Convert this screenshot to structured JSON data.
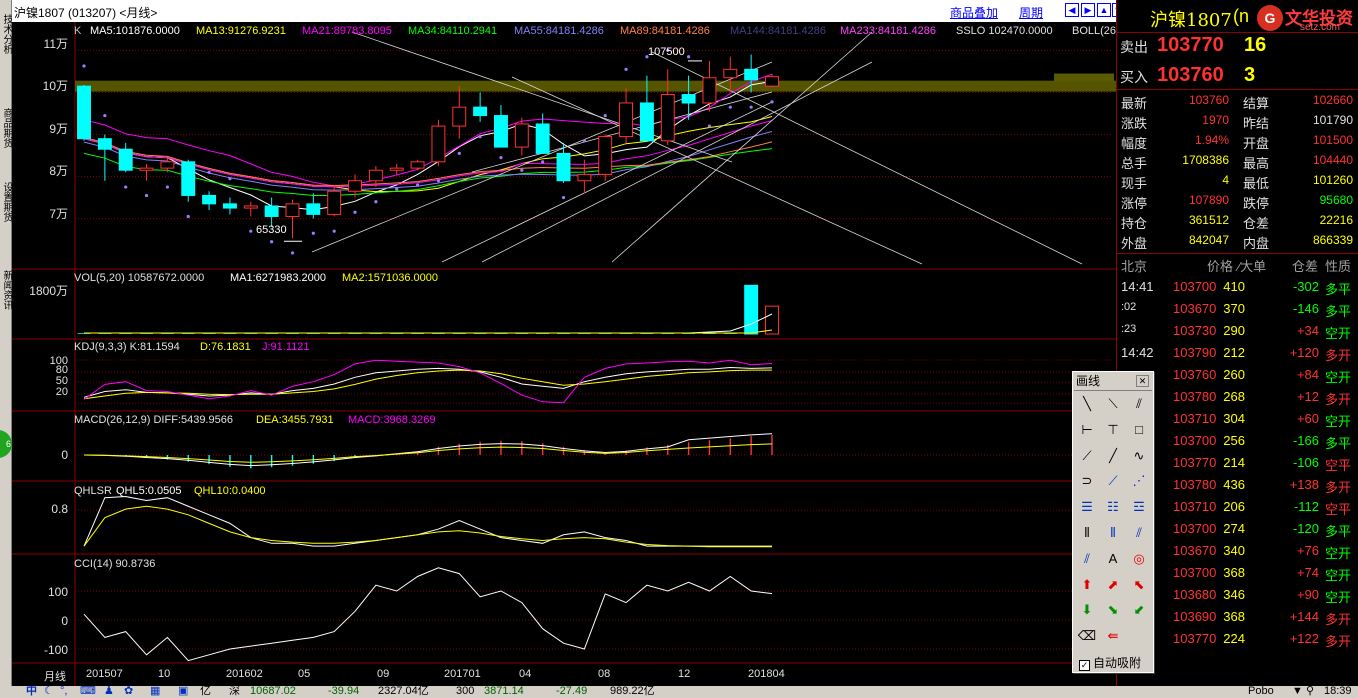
{
  "title_bar": {
    "title": "沪镍1807 (013207) <月线>",
    "link_overlay": "商品叠加",
    "link_period": "周期"
  },
  "left_tabs": [
    "技术分析",
    "商品期货",
    "设置期货",
    "新闻资讯"
  ],
  "chart_labels": {
    "k_name": "K",
    "ma5": "MA5:101876.0000",
    "ma13": "MA13:91276.9231",
    "ma21": "MA21:89783.8095",
    "ma34": "MA34:84110.2941",
    "ma55": "MA55:84181.4286",
    "ma89": "MA89:84181.4286",
    "ma144": "MA144:84181.4286",
    "ma233": "MA233:84181.4286",
    "sslo": "SSLO 102470.0000",
    "boll": "BOLL(26",
    "annot_high": "107500",
    "annot_low": "65330",
    "vol": "VOL(5,20) 10587672.0000",
    "vol_ma1": "MA1:6271983.2000",
    "vol_ma2": "MA2:1571036.0000",
    "kdj": "KDJ(9,3,3) K:81.1594",
    "kdj_d": "D:76.1831",
    "kdj_j": "J:91.1121",
    "macd": "MACD(26,12,9) DIFF:5439.9566",
    "macd_dea": "DEA:3455.7931",
    "macd_val": "MACD:3968.3269",
    "qhlsr": "QHLSR",
    "qhl5": "QHL5:0.0505",
    "qhl10": "QHL10:0.0400",
    "cci": "CCI(14) 90.8736"
  },
  "y_ticks": {
    "price": [
      "11万",
      "10万",
      "9万",
      "8万",
      "7万"
    ],
    "vol": [
      "1800万"
    ],
    "kdj": [
      "100",
      "80",
      "50",
      "20"
    ],
    "macd": [
      "0"
    ],
    "qhlsr": [
      "0.8"
    ],
    "cci": [
      "100",
      "0",
      "-100"
    ]
  },
  "x_axis": {
    "label": "月线",
    "ticks": [
      "201507",
      "10",
      "201602",
      "05",
      "09",
      "201701",
      "04",
      "08",
      "12",
      "201804"
    ]
  },
  "quote": {
    "symbol": "沪镍1807",
    "symbol_code": "(n",
    "brand": "文华投资",
    "brand_url": "setz.com",
    "sell": {
      "label": "卖出",
      "price": "103770",
      "qty": "16"
    },
    "buy": {
      "label": "买入",
      "price": "103760",
      "qty": "3"
    },
    "fields": [
      {
        "l1": "最新",
        "v1": "103760",
        "l2": "结算",
        "v2": "102660"
      },
      {
        "l1": "涨跌",
        "v1": "1970",
        "l2": "昨结",
        "v2": "101790"
      },
      {
        "l1": "幅度",
        "v1": "1.94%",
        "l2": "开盘",
        "v2": "101500"
      },
      {
        "l1": "总手",
        "v1": "1708386",
        "l2": "最高",
        "v2": "104440"
      },
      {
        "l1": "现手",
        "v1": "4",
        "l2": "最低",
        "v2": "101260"
      },
      {
        "l1": "涨停",
        "v1": "107890",
        "l2": "跌停",
        "v2": "95680"
      },
      {
        "l1": "持仓",
        "v1": "361512",
        "l2": "仓差",
        "v2": "22216"
      },
      {
        "l1": "外盘",
        "v1": "842047",
        "l2": "内盘",
        "v2": "866339"
      }
    ],
    "ticks_header": {
      "city": "北京",
      "price": "价格",
      "big": "⁄大单",
      "diff": "仓差",
      "nature": "性质"
    },
    "ticks": [
      {
        "time": "14:41",
        "price": "103700",
        "vol": "410",
        "diff": "-302",
        "nature": "多平"
      },
      {
        "time": ":02",
        "price": "103670",
        "vol": "370",
        "diff": "-146",
        "nature": "多平"
      },
      {
        "time": ":23",
        "price": "103730",
        "vol": "290",
        "diff": "+34",
        "nature": "空开"
      },
      {
        "time": "14:42",
        "price": "103790",
        "vol": "212",
        "diff": "+120",
        "nature": "多开"
      },
      {
        "time": "",
        "price": "103760",
        "vol": "260",
        "diff": "+84",
        "nature": "空开"
      },
      {
        "time": "",
        "price": "103780",
        "vol": "268",
        "diff": "+12",
        "nature": "多开"
      },
      {
        "time": "",
        "price": "103710",
        "vol": "304",
        "diff": "+60",
        "nature": "空开"
      },
      {
        "time": "",
        "price": "103700",
        "vol": "256",
        "diff": "-166",
        "nature": "多平"
      },
      {
        "time": "",
        "price": "103770",
        "vol": "214",
        "diff": "-106",
        "nature": "空平"
      },
      {
        "time": "",
        "price": "103780",
        "vol": "436",
        "diff": "+138",
        "nature": "多开"
      },
      {
        "time": "",
        "price": "103710",
        "vol": "206",
        "diff": "-112",
        "nature": "空平"
      },
      {
        "time": "",
        "price": "103700",
        "vol": "274",
        "diff": "-120",
        "nature": "多平"
      },
      {
        "time": "",
        "price": "103670",
        "vol": "340",
        "diff": "+76",
        "nature": "空开"
      },
      {
        "time": "",
        "price": "103700",
        "vol": "368",
        "diff": "+74",
        "nature": "空开"
      },
      {
        "time": "",
        "price": "103680",
        "vol": "346",
        "diff": "+90",
        "nature": "空开"
      },
      {
        "time": "",
        "price": "103690",
        "vol": "368",
        "diff": "+144",
        "nature": "多开"
      },
      {
        "time": "",
        "price": "103770",
        "vol": "224",
        "diff": "+122",
        "nature": "多开"
      }
    ]
  },
  "draw_tools": {
    "title": "画线",
    "auto_snap": "自动吸附"
  },
  "status_bar": {
    "ime": "中",
    "sh_label": "亿",
    "sz_label": "深",
    "sz_val": "10687.02",
    "sz_chg": "-39.94",
    "sz_amt": "2327.04亿",
    "i300_label": "300",
    "i300_val": "3871.14",
    "i300_chg": "-27.49",
    "i300_amt": "989.22亿",
    "right_text": "Pobo",
    "clock": "18:39"
  },
  "colors": {
    "up": "#ff3232",
    "down": "#00ffff",
    "ma5": "#ffffff",
    "ma13": "#ffff00",
    "ma21": "#ff00ff",
    "ma34": "#00ff00",
    "ma55": "#8080ff",
    "ma89": "#ff8040",
    "title_link": "#0000ff"
  },
  "chart_data": {
    "type": "candlestick",
    "period": "monthly",
    "x": [
      "201507",
      "201508",
      "201509",
      "201510",
      "201511",
      "201512",
      "201601",
      "201602",
      "201603",
      "201604",
      "201605",
      "201606",
      "201607",
      "201608",
      "201609",
      "201610",
      "201611",
      "201612",
      "201701",
      "201702",
      "201703",
      "201704",
      "201705",
      "201706",
      "201707",
      "201708",
      "201709",
      "201710",
      "201711",
      "201712",
      "201801",
      "201802",
      "201803",
      "201804"
    ],
    "ohlc": [
      [
        101500,
        101800,
        88500,
        89000
      ],
      [
        89000,
        90000,
        79000,
        86500
      ],
      [
        86500,
        88000,
        81000,
        81500
      ],
      [
        81500,
        83000,
        79000,
        82000
      ],
      [
        82000,
        84500,
        81000,
        83500
      ],
      [
        83500,
        84000,
        74000,
        75500
      ],
      [
        75500,
        76500,
        72000,
        73500
      ],
      [
        73500,
        75000,
        71000,
        72500
      ],
      [
        72500,
        74000,
        70500,
        73000
      ],
      [
        73000,
        75000,
        68000,
        70500
      ],
      [
        70500,
        74500,
        65330,
        73500
      ],
      [
        73500,
        76000,
        70000,
        71000
      ],
      [
        71000,
        78000,
        70500,
        76500
      ],
      [
        76500,
        80500,
        75000,
        79000
      ],
      [
        79000,
        82500,
        77500,
        81500
      ],
      [
        81500,
        83000,
        80500,
        82000
      ],
      [
        82000,
        84000,
        81500,
        83500
      ],
      [
        83500,
        93500,
        82500,
        92000
      ],
      [
        92000,
        101500,
        89000,
        96500
      ],
      [
        96500,
        100000,
        93000,
        94500
      ],
      [
        94500,
        97000,
        88000,
        87000
      ],
      [
        87000,
        94000,
        85000,
        92500
      ],
      [
        92500,
        95000,
        87000,
        85500
      ],
      [
        85500,
        88000,
        78500,
        79000
      ],
      [
        79000,
        84000,
        76000,
        80500
      ],
      [
        80500,
        90000,
        79000,
        89500
      ],
      [
        89500,
        101000,
        88000,
        97500
      ],
      [
        97500,
        104000,
        89500,
        88500
      ],
      [
        88500,
        105500,
        87500,
        99500
      ],
      [
        99500,
        104000,
        93500,
        97500
      ],
      [
        97500,
        107500,
        95500,
        103500
      ],
      [
        103500,
        108500,
        100000,
        105500
      ],
      [
        105500,
        109000,
        100000,
        103000
      ],
      [
        101500,
        104440,
        101260,
        103760
      ]
    ],
    "volume_last_two": [
      18500000,
      10587672
    ],
    "y_ticks": [
      70000,
      80000,
      90000,
      100000,
      110000
    ],
    "annotations": {
      "high": 107500,
      "low": 65330
    }
  }
}
